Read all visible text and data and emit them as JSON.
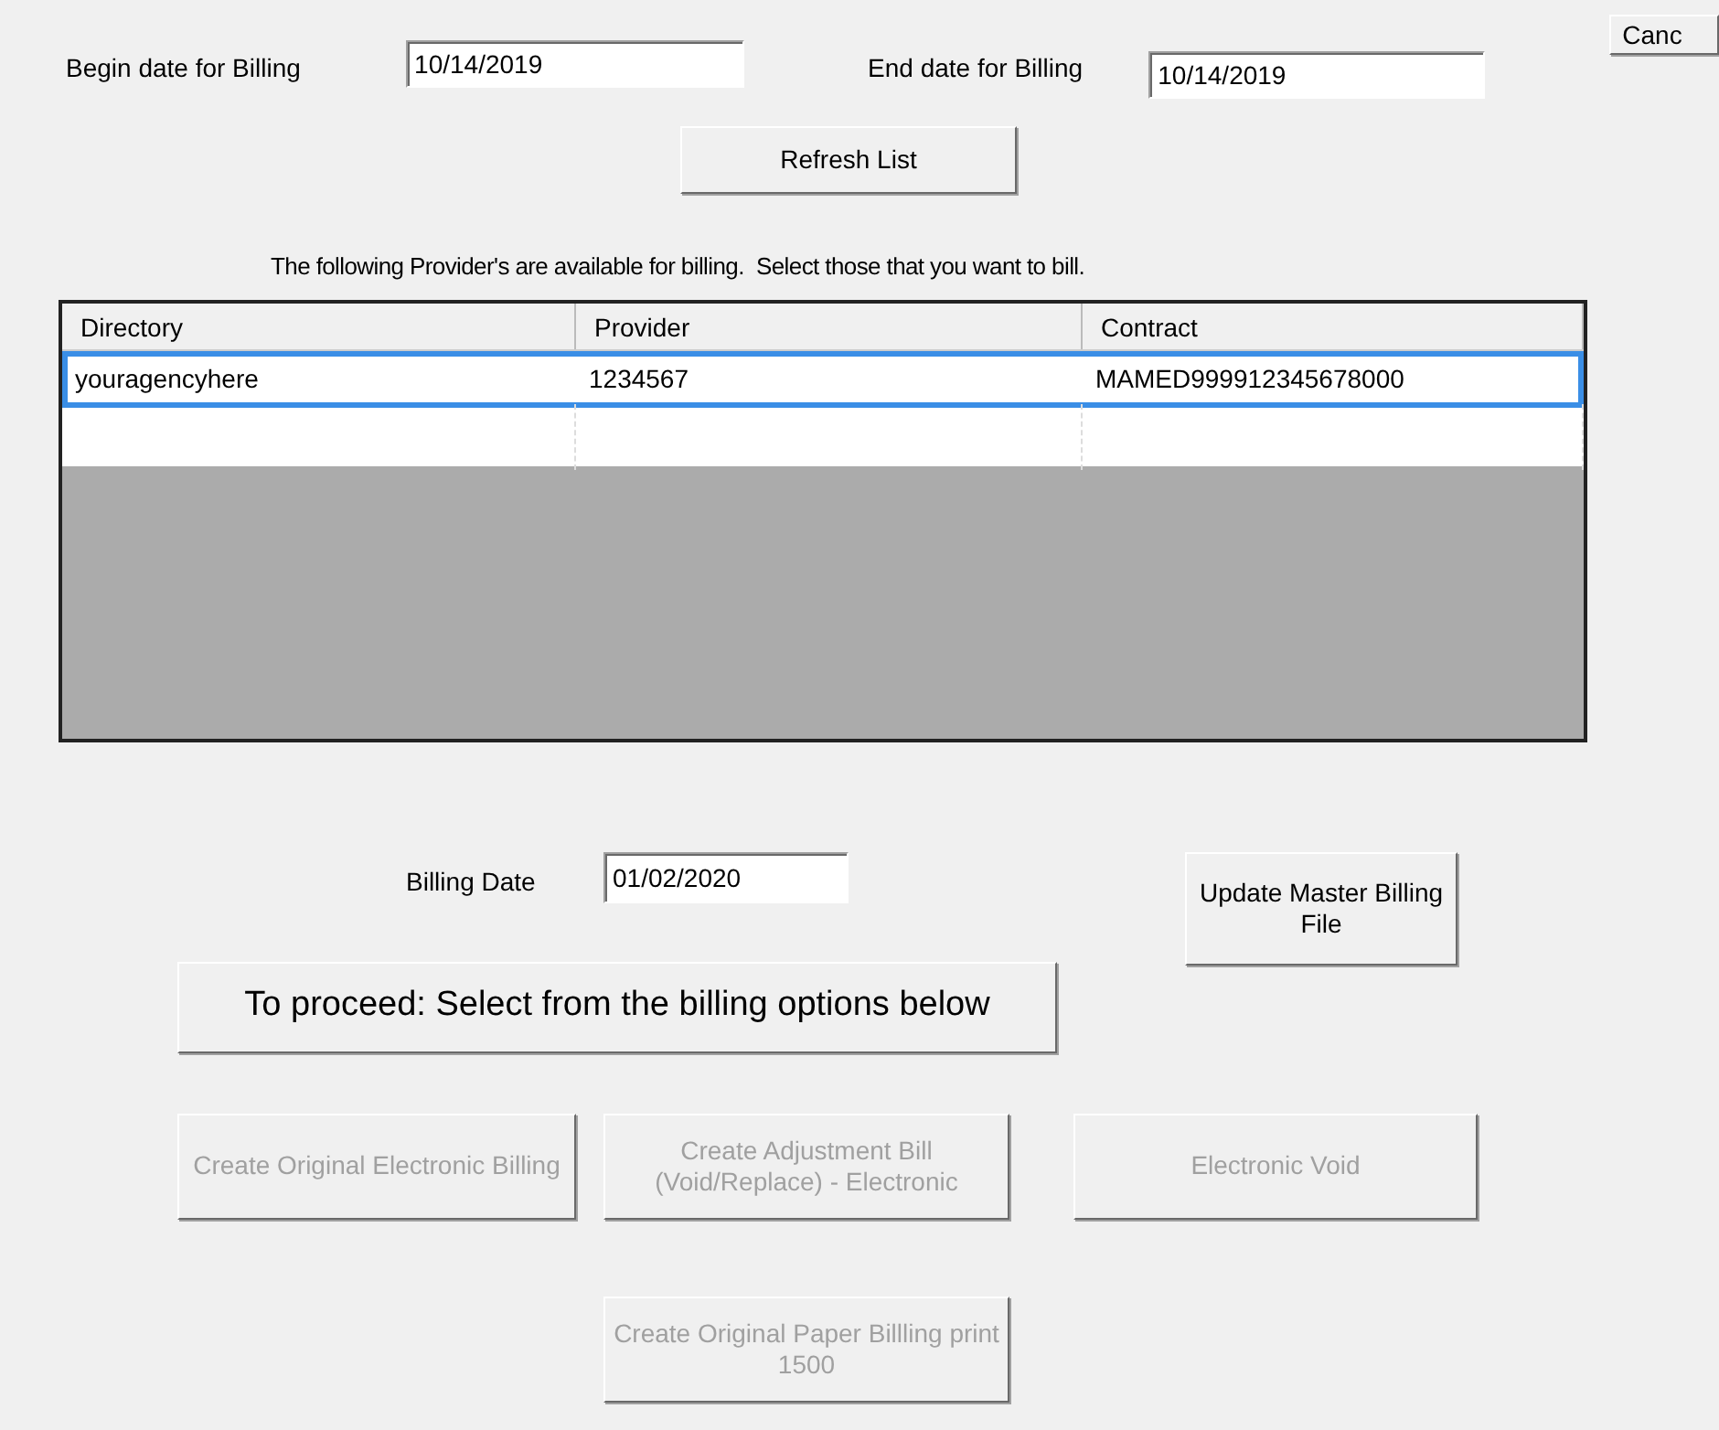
{
  "cancel_button": {
    "label": "Canc"
  },
  "begin_date": {
    "label": "Begin date for Billing",
    "value": "10/14/2019"
  },
  "end_date": {
    "label": "End date for Billing",
    "value": "10/14/2019"
  },
  "refresh_button": {
    "label": "Refresh List"
  },
  "instructions": "The following Provider's are available for billing.  Select those that you want to bill.",
  "table": {
    "columns": [
      "Directory",
      "Provider",
      "Contract"
    ],
    "rows": [
      {
        "cells": [
          "youragencyhere",
          "1234567",
          "MAMED999912345678000"
        ],
        "selected": true
      },
      {
        "cells": [
          "",
          "",
          ""
        ],
        "selected": false
      }
    ]
  },
  "billing_date": {
    "label": "Billing Date",
    "value": "01/02/2020"
  },
  "update_button": {
    "label": "Update Master Billing File",
    "disabled": false
  },
  "proceed_button": {
    "label": "To proceed: Select from the billing options below"
  },
  "option_buttons": [
    {
      "label": "Create Original Electronic Billing",
      "disabled": true
    },
    {
      "label": "Create Adjustment Bill (Void/Replace) - Electronic",
      "disabled": true
    },
    {
      "label": "Electronic Void",
      "disabled": true
    },
    {
      "label": "Create Original Paper Billling print 1500",
      "disabled": true
    }
  ]
}
